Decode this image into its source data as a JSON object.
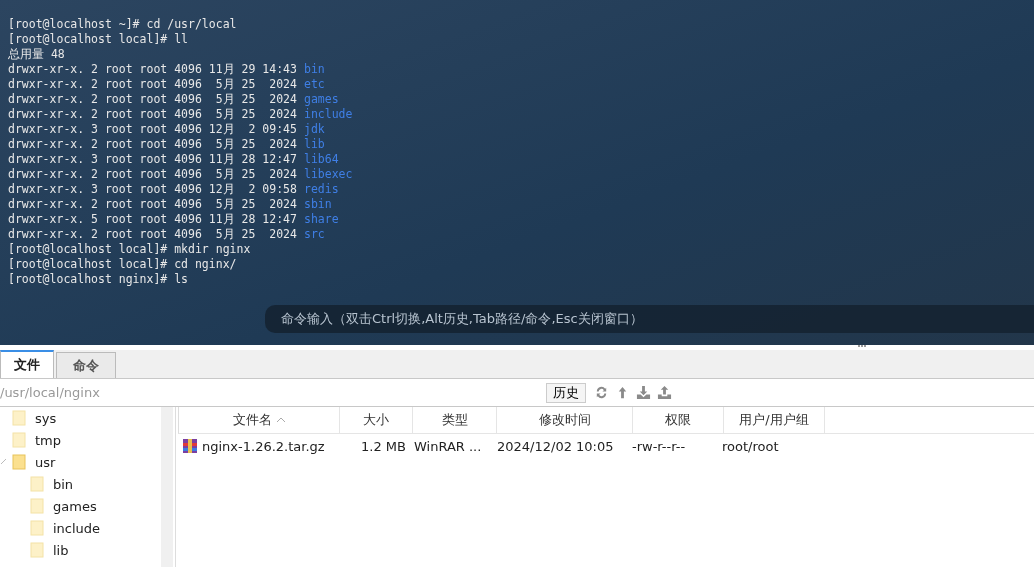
{
  "terminal": {
    "lines": [
      {
        "kind": "prompt",
        "text": "[root@localhost ~]# cd /usr/local"
      },
      {
        "kind": "prompt",
        "text": "[root@localhost local]# ll"
      },
      {
        "kind": "prompt",
        "text": "总用量 48"
      },
      {
        "kind": "entry",
        "info": "drwxr-xr-x. 2 root root 4096 11月 29 14:43",
        "name": "bin"
      },
      {
        "kind": "entry",
        "info": "drwxr-xr-x. 2 root root 4096  5月 25  2024",
        "name": "etc"
      },
      {
        "kind": "entry",
        "info": "drwxr-xr-x. 2 root root 4096  5月 25  2024",
        "name": "games"
      },
      {
        "kind": "entry",
        "info": "drwxr-xr-x. 2 root root 4096  5月 25  2024",
        "name": "include"
      },
      {
        "kind": "entry",
        "info": "drwxr-xr-x. 3 root root 4096 12月  2 09:45",
        "name": "jdk"
      },
      {
        "kind": "entry",
        "info": "drwxr-xr-x. 2 root root 4096  5月 25  2024",
        "name": "lib"
      },
      {
        "kind": "entry",
        "info": "drwxr-xr-x. 3 root root 4096 11月 28 12:47",
        "name": "lib64"
      },
      {
        "kind": "entry",
        "info": "drwxr-xr-x. 2 root root 4096  5月 25  2024",
        "name": "libexec"
      },
      {
        "kind": "entry",
        "info": "drwxr-xr-x. 3 root root 4096 12月  2 09:58",
        "name": "redis"
      },
      {
        "kind": "entry",
        "info": "drwxr-xr-x. 2 root root 4096  5月 25  2024",
        "name": "sbin"
      },
      {
        "kind": "entry",
        "info": "drwxr-xr-x. 5 root root 4096 11月 28 12:47",
        "name": "share"
      },
      {
        "kind": "entry",
        "info": "drwxr-xr-x. 2 root root 4096  5月 25  2024",
        "name": "src"
      },
      {
        "kind": "prompt",
        "text": "[root@localhost local]# mkdir nginx"
      },
      {
        "kind": "prompt",
        "text": "[root@localhost local]# cd nginx/"
      },
      {
        "kind": "prompt",
        "text": "[root@localhost nginx]# ls"
      }
    ],
    "command_hint": "命令输入（双击Ctrl切换,Alt历史,Tab路径/命令,Esc关闭窗口）"
  },
  "tabs": [
    {
      "label": "文件",
      "selected": true
    },
    {
      "label": "命令",
      "selected": false
    }
  ],
  "path": {
    "value": "/usr/local/nginx"
  },
  "history_button": "历史",
  "tree": [
    {
      "name": "sys",
      "selected": false,
      "expanded": false
    },
    {
      "name": "tmp",
      "selected": false,
      "expanded": false
    },
    {
      "name": "usr",
      "selected": true,
      "expanded": true,
      "children": [
        {
          "name": "bin",
          "selected": false
        },
        {
          "name": "games",
          "selected": false
        },
        {
          "name": "include",
          "selected": false
        },
        {
          "name": "lib",
          "selected": false
        }
      ]
    }
  ],
  "table": {
    "columns": [
      {
        "label": "文件名",
        "sorted": true
      },
      {
        "label": "大小",
        "sorted": false
      },
      {
        "label": "类型",
        "sorted": false
      },
      {
        "label": "修改时间",
        "sorted": false
      },
      {
        "label": "权限",
        "sorted": false
      },
      {
        "label": "用户/用户组",
        "sorted": false
      }
    ],
    "rows": [
      {
        "cells": [
          "nginx-1.26.2.tar.gz",
          "1.2 MB",
          "WinRAR ...",
          "2024/12/02 10:05",
          "-rw-r--r--",
          "root/root"
        ]
      }
    ]
  }
}
